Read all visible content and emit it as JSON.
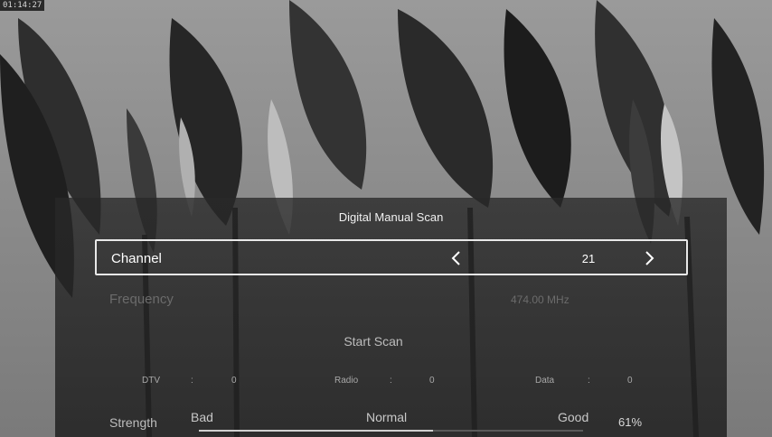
{
  "status": {
    "time": "01:14:27"
  },
  "dialog": {
    "title": "Digital Manual Scan",
    "channel": {
      "label": "Channel",
      "value": "21",
      "prev_icon": "chevron-left-icon",
      "next_icon": "chevron-right-icon"
    },
    "frequency": {
      "label": "Frequency",
      "value": "474.00 MHz"
    },
    "start_scan_label": "Start Scan",
    "stats": [
      {
        "label": "DTV",
        "sep": ":",
        "value": "0"
      },
      {
        "label": "Radio",
        "sep": ":",
        "value": "0"
      },
      {
        "label": "Data",
        "sep": ":",
        "value": "0"
      }
    ],
    "strength": {
      "label": "Strength",
      "scale": [
        "Bad",
        "Normal",
        "Good"
      ],
      "percent_text": "61%",
      "level": 0.61
    }
  },
  "colors": {
    "panel": "#2a2a2a",
    "text": "#ffffff",
    "dimmed": "#6b6b6b"
  }
}
